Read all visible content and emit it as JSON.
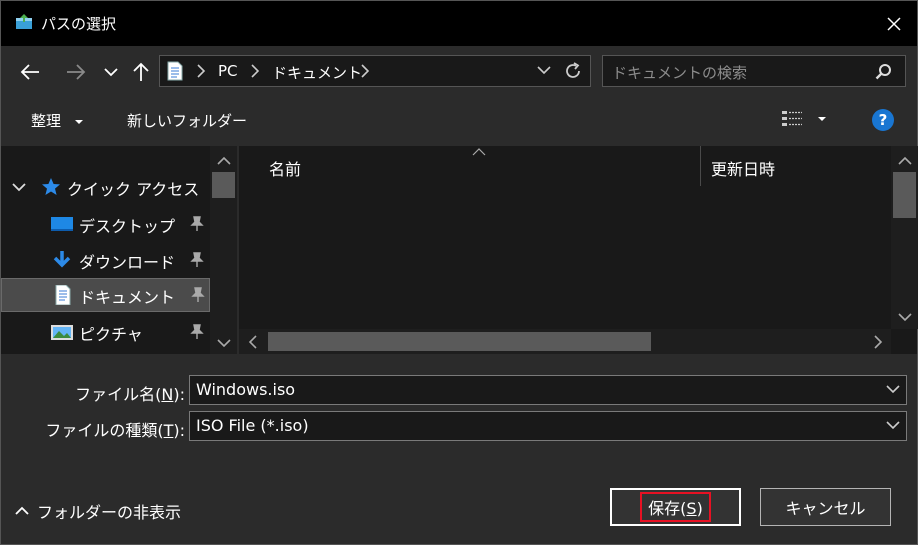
{
  "window": {
    "title": "パスの選択"
  },
  "nav": {
    "breadcrumbs": [
      "PC",
      "ドキュメント"
    ]
  },
  "search": {
    "placeholder": "ドキュメントの検索"
  },
  "toolbar": {
    "organize": "整理",
    "new_folder": "新しいフォルダー",
    "help": "?"
  },
  "sidebar": {
    "quick_access": "クイック アクセス",
    "items": [
      {
        "label": "デスクトップ"
      },
      {
        "label": "ダウンロード"
      },
      {
        "label": "ドキュメント"
      },
      {
        "label": "ピクチャ"
      }
    ]
  },
  "filelist": {
    "col_name": "名前",
    "col_date": "更新日時"
  },
  "form": {
    "filename_label_pre": "ファイル名(",
    "filename_label_key": "N",
    "filename_label_post": "):",
    "filename_value": "Windows.iso",
    "filetype_label_pre": "ファイルの種類(",
    "filetype_label_key": "T",
    "filetype_label_post": "):",
    "filetype_value": "ISO File (*.iso)"
  },
  "footer": {
    "hide_folders": "フォルダーの非表示",
    "save_pre": "保存(",
    "save_key": "S",
    "save_post": ")",
    "cancel": "キャンセル"
  },
  "colors": {
    "accent": "#1976d2",
    "focus": "#e81123",
    "bg": "#2b2b2b",
    "pane": "#191919"
  },
  "icons": [
    "app-icon",
    "close-icon",
    "back-arrow-icon",
    "forward-arrow-icon",
    "chevron-down-icon",
    "up-arrow-icon",
    "document-icon",
    "chevron-right-icon",
    "refresh-icon",
    "search-icon",
    "view-list-icon",
    "help-icon",
    "star-icon",
    "desktop-icon",
    "download-icon",
    "picture-icon",
    "pin-icon",
    "chevron-up-icon"
  ]
}
